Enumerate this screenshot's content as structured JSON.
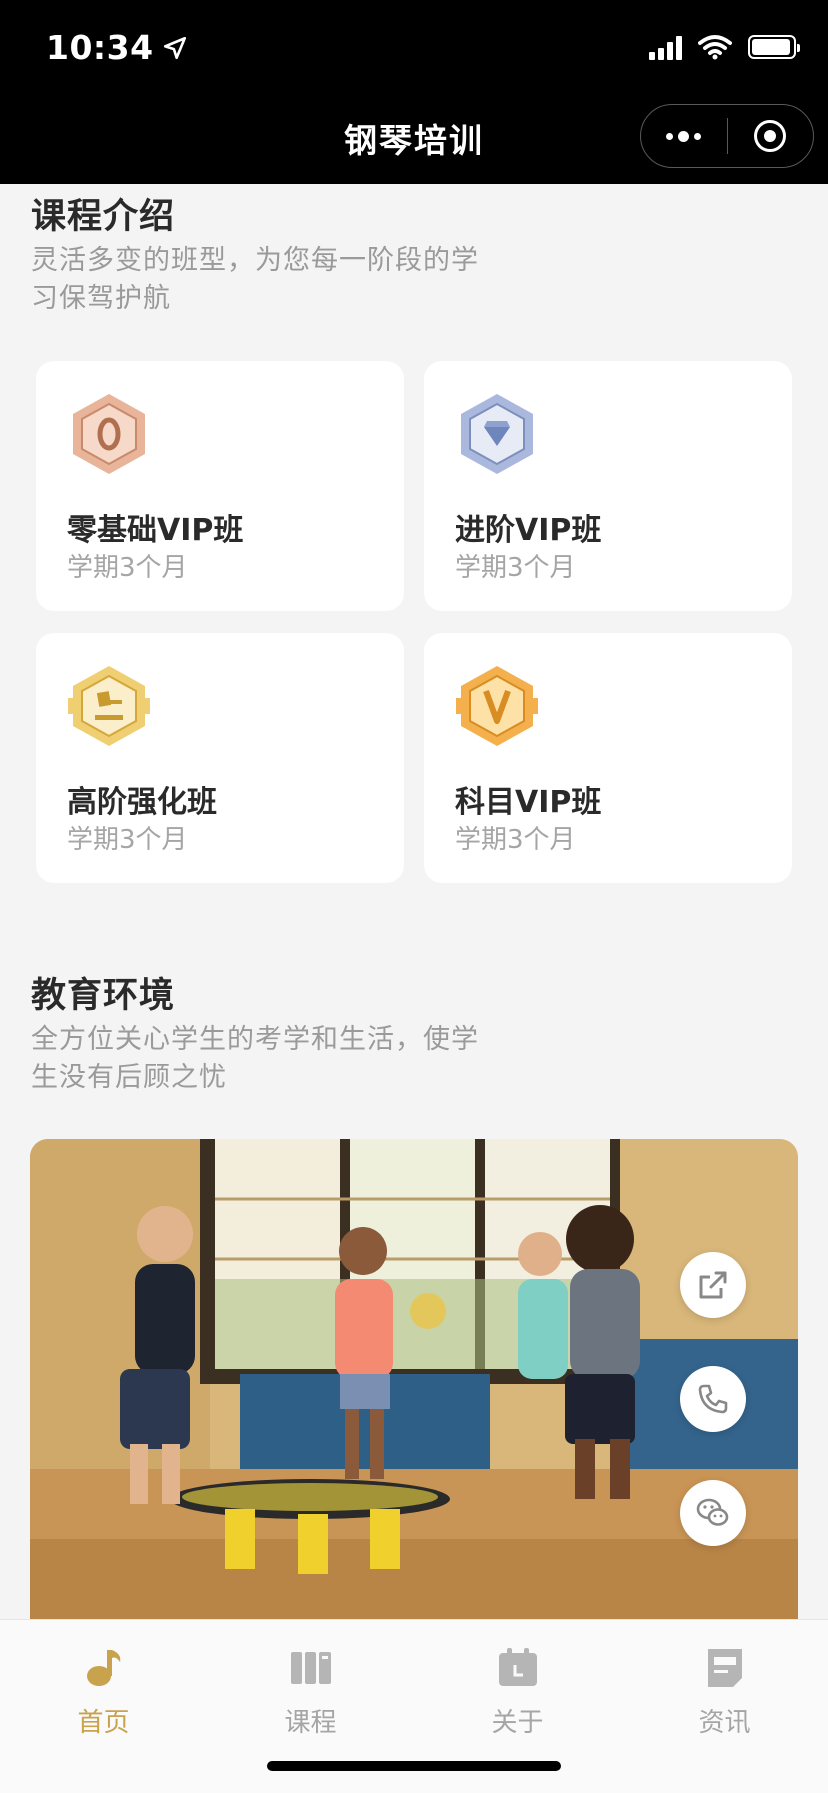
{
  "status_bar": {
    "time": "10:34"
  },
  "nav": {
    "title": "钢琴培训"
  },
  "course_section": {
    "title": "课程介绍",
    "description": "灵活多变的班型，为您每一阶段的学习保驾护航"
  },
  "courses": [
    {
      "name": "零基础VIP班",
      "term": "学期3个月",
      "icon": "zero-hexagon-icon"
    },
    {
      "name": "进阶VIP班",
      "term": "学期3个月",
      "icon": "diamond-hexagon-icon"
    },
    {
      "name": "高阶强化班",
      "term": "学期3个月",
      "icon": "gavel-hexagon-icon"
    },
    {
      "name": "科目VIP班",
      "term": "学期3个月",
      "icon": "v-hexagon-icon"
    }
  ],
  "environment_section": {
    "title": "教育环境",
    "description": "全方位关心学生的考学和生活，使学生没有后顾之忧"
  },
  "floating_actions": [
    "share-icon",
    "phone-icon",
    "wechat-icon"
  ],
  "tabbar": {
    "items": [
      {
        "label": "首页",
        "icon": "music-note-icon",
        "active": true
      },
      {
        "label": "课程",
        "icon": "books-icon",
        "active": false
      },
      {
        "label": "关于",
        "icon": "calendar-icon",
        "active": false
      },
      {
        "label": "资讯",
        "icon": "news-icon",
        "active": false
      }
    ]
  },
  "colors": {
    "accent": "#c9a24d",
    "background": "#f4f4f4",
    "bronze": "#d79b7e",
    "silver": "#8fa3c9",
    "gold": "#e8b94a",
    "orange": "#f0a83c"
  }
}
